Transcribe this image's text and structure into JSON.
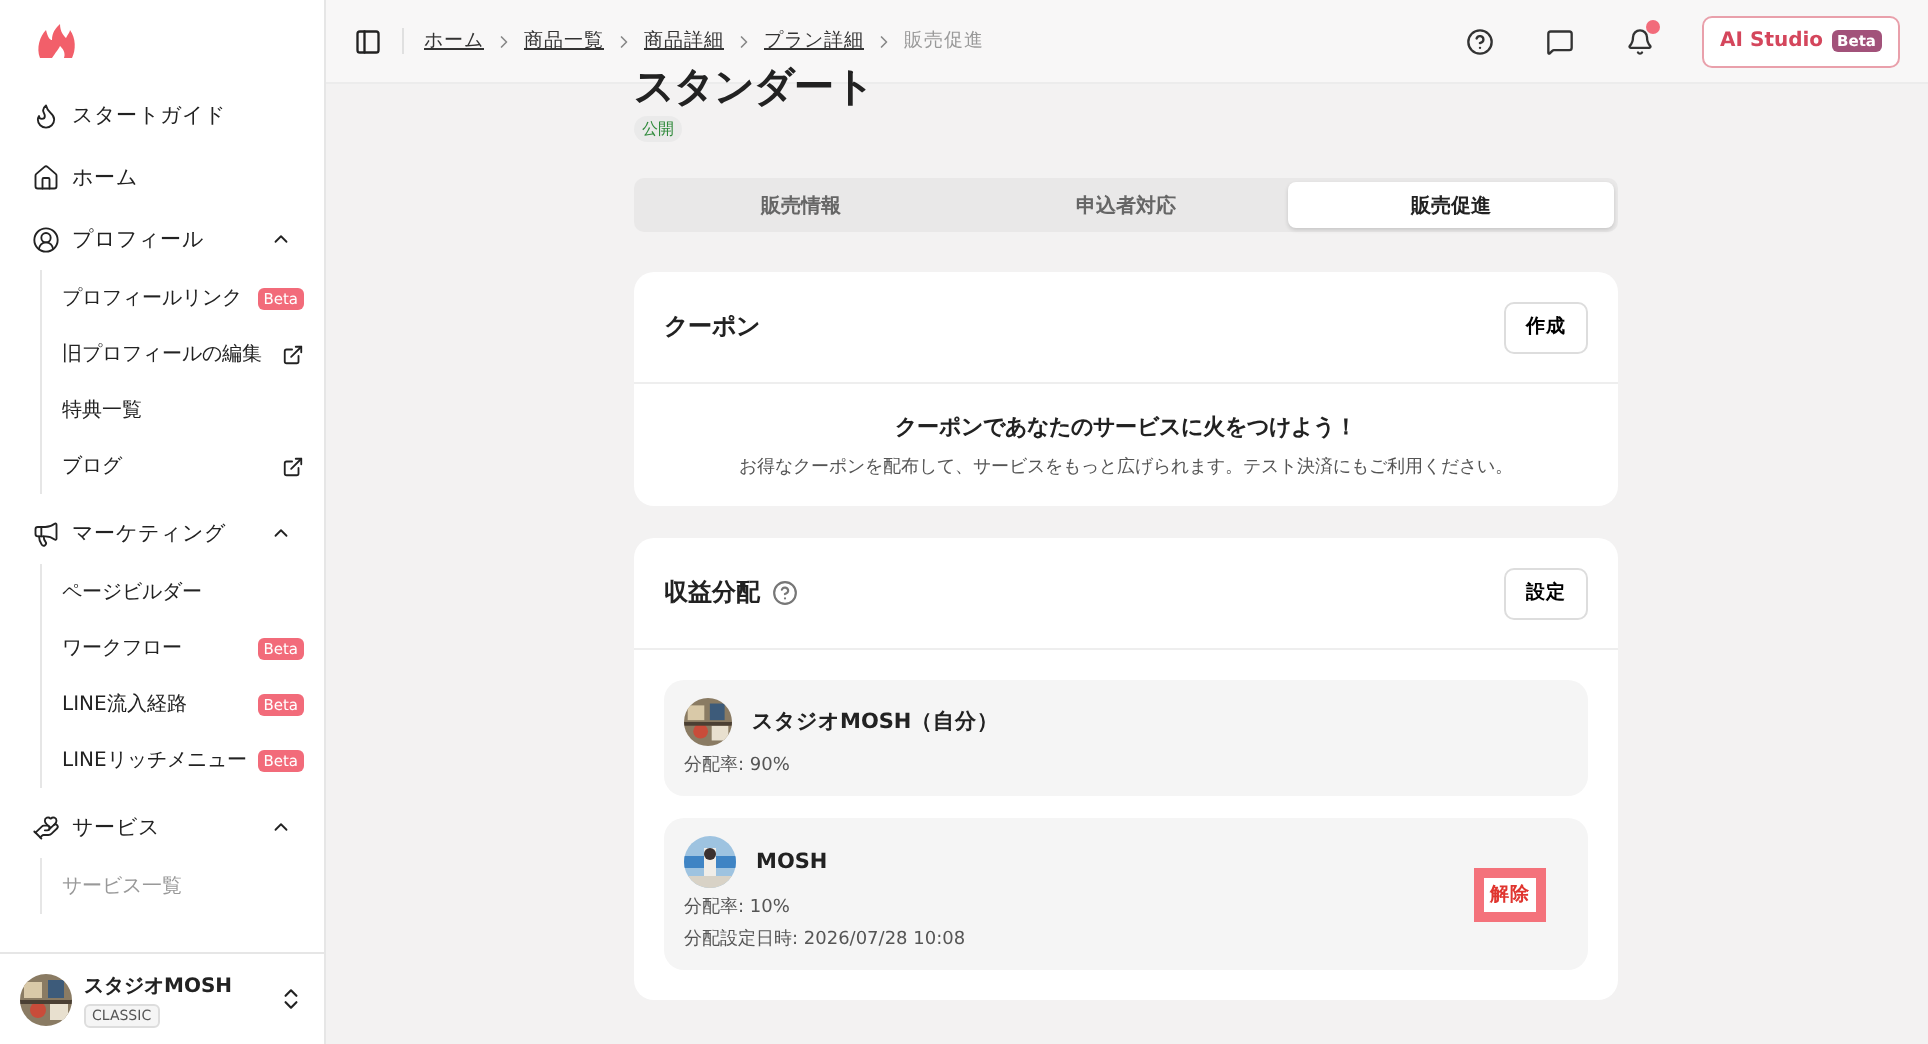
{
  "sidebar": {
    "nav": [
      {
        "kind": "item",
        "label": "スタートガイド"
      },
      {
        "kind": "item",
        "label": "ホーム"
      },
      {
        "kind": "group",
        "label": "プロフィール",
        "expanded": true,
        "children": [
          {
            "label": "プロフィールリンク",
            "badge": "Beta"
          },
          {
            "label": "旧プロフィールの編集",
            "external": true
          },
          {
            "label": "特典一覧"
          },
          {
            "label": "ブログ",
            "external": true
          }
        ]
      },
      {
        "kind": "group",
        "label": "マーケティング",
        "expanded": true,
        "children": [
          {
            "label": "ページビルダー"
          },
          {
            "label": "ワークフロー",
            "badge": "Beta"
          },
          {
            "label": "LINE流入経路",
            "badge": "Beta"
          },
          {
            "label": "LINEリッチメニュー",
            "badge": "Beta"
          }
        ]
      },
      {
        "kind": "group",
        "label": "サービス",
        "expanded": true,
        "children": [
          {
            "label": "サービス一覧",
            "faded": true
          }
        ]
      }
    ],
    "account": {
      "name": "スタジオMOSH",
      "plan": "CLASSIC"
    }
  },
  "breadcrumbs": [
    {
      "label": "ホーム",
      "current": false
    },
    {
      "label": "商品一覧",
      "current": false
    },
    {
      "label": "商品詳細",
      "current": false
    },
    {
      "label": "プラン詳細",
      "current": false
    },
    {
      "label": "販売促進",
      "current": true
    }
  ],
  "header": {
    "notification_dot": true,
    "ai_button": {
      "label": "AI Studio",
      "badge": "Beta"
    }
  },
  "plan": {
    "title": "スタンダート",
    "status": "公開"
  },
  "tabs": [
    {
      "label": "販売情報",
      "selected": false
    },
    {
      "label": "申込者対応",
      "selected": false
    },
    {
      "label": "販売促進",
      "selected": true
    }
  ],
  "coupon": {
    "title": "クーポン",
    "button": "作成",
    "heading": "クーポンであなたのサービスに火をつけよう！",
    "description": "お得なクーポンを配布して、サービスをもっと広げられます。テスト決済にもご利用ください。"
  },
  "revenue": {
    "title": "収益分配",
    "button": "設定",
    "members": [
      {
        "name": "スタジオMOSH（自分）",
        "rate": "分配率: 90%"
      },
      {
        "name": "MOSH",
        "rate": "分配率: 10%",
        "date": "分配設定日時: 2026/07/28 10:08",
        "action": "解除"
      }
    ]
  }
}
